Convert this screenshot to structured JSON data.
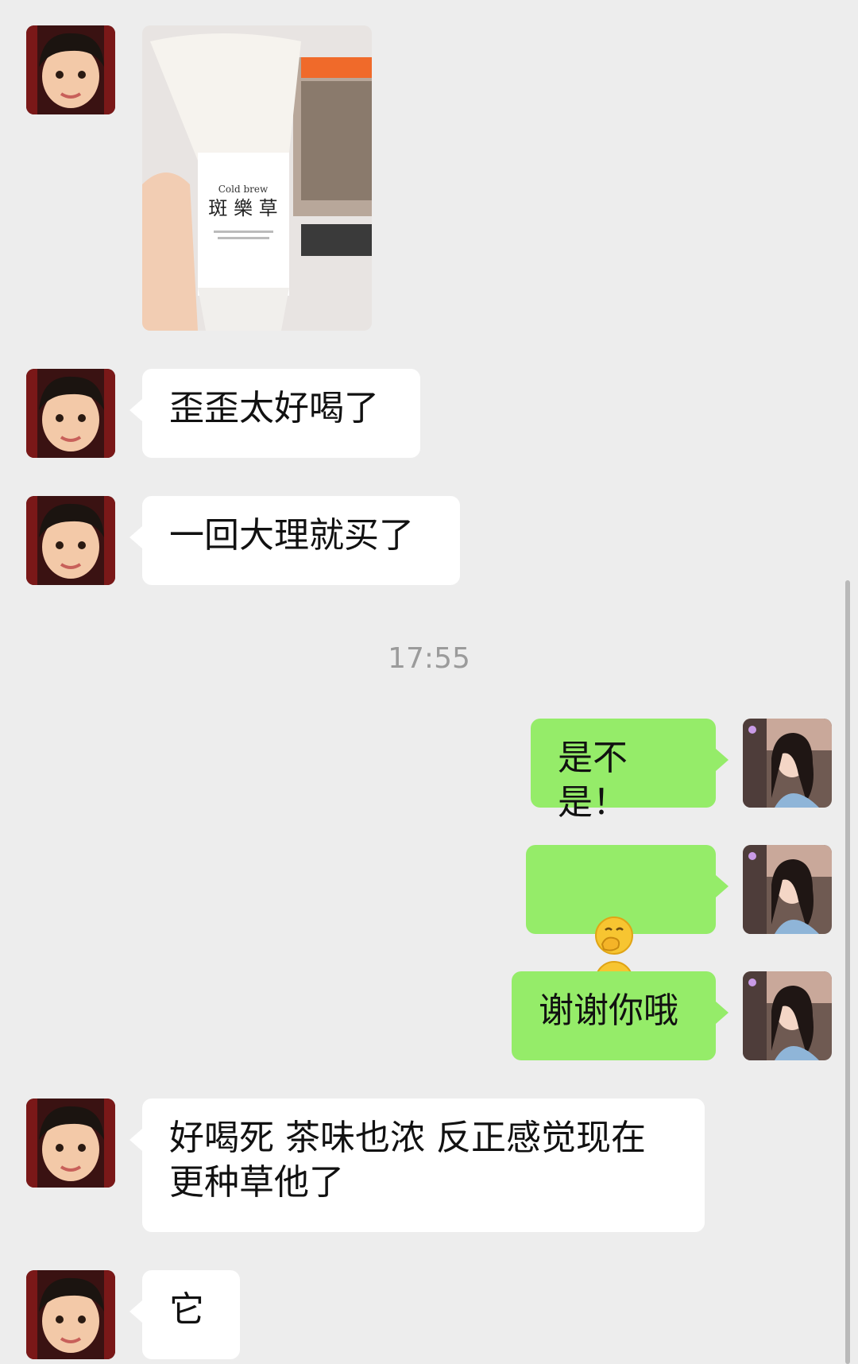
{
  "conversation": {
    "messages": [
      {
        "side": "left",
        "type": "image",
        "description_icon": "milk-tea-cup-photo",
        "cup_logo": "Cold brew"
      },
      {
        "side": "left",
        "type": "text",
        "text": "歪歪太好喝了"
      },
      {
        "side": "left",
        "type": "text",
        "text": "一回大理就买了"
      },
      {
        "type": "timestamp",
        "text": "17:55"
      },
      {
        "side": "right",
        "type": "text",
        "text": "是不是！"
      },
      {
        "side": "right",
        "type": "emoji",
        "emoji_count": 3,
        "emoji_icon": "face-with-hand-over-mouth-icon"
      },
      {
        "side": "right",
        "type": "text",
        "text": "谢谢你哦"
      },
      {
        "side": "left",
        "type": "text",
        "text": "好喝死 茶味也浓 反正感觉现在\n更种草他了"
      },
      {
        "side": "left",
        "type": "text",
        "text": "它"
      }
    ]
  },
  "colors": {
    "background": "#ededed",
    "incoming_bubble": "#ffffff",
    "outgoing_bubble": "#95ec69",
    "timestamp_text": "#9b9b9b"
  },
  "icons": {
    "contact_avatar": "child-avatar",
    "self_avatar": "woman-avatar"
  }
}
